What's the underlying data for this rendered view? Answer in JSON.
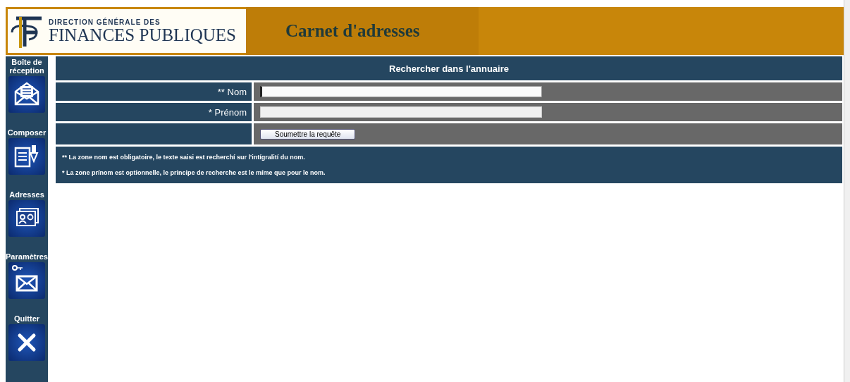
{
  "header": {
    "logo_small": "DIRECTION GÉNÉRALE DES",
    "logo_large": "FINANCES PUBLIQUES",
    "title": "Carnet d'adresses"
  },
  "sidebar": {
    "items": [
      {
        "label": "Boîte de réception"
      },
      {
        "label": "Composer"
      },
      {
        "label": "Adresses"
      },
      {
        "label": "Paramètres"
      },
      {
        "label": "Quitter"
      }
    ]
  },
  "form": {
    "title": "Rechercher dans l'annuaire",
    "fields": [
      {
        "label": "** Nom",
        "focused": true
      },
      {
        "label": "* Prénom",
        "focused": false
      }
    ],
    "submit": "Soumettre la requête",
    "notes": [
      "** La zone nom est obligatoire, le texte saisi est recherchí sur l'intígralití du nom.",
      "* La zone prínom est optionnelle, le principe de recherche est le míme que pour le nom."
    ]
  }
}
